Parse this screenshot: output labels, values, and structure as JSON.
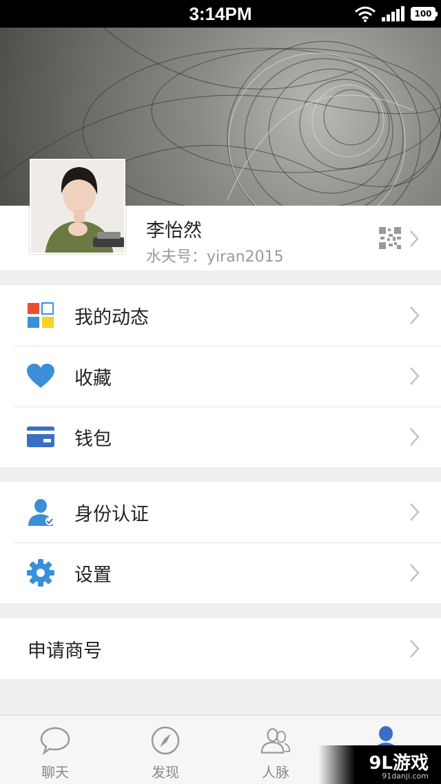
{
  "status_bar": {
    "time": "3:14PM",
    "battery": "100"
  },
  "profile": {
    "name": "李怡然",
    "account_label": "水夫号：",
    "account_id": "yiran2015"
  },
  "menu_group_1": [
    {
      "label": "我的动态",
      "icon": "moments-icon"
    },
    {
      "label": "收藏",
      "icon": "heart-icon"
    },
    {
      "label": "钱包",
      "icon": "wallet-card-icon"
    }
  ],
  "menu_group_2": [
    {
      "label": "身份认证",
      "icon": "verified-user-icon"
    },
    {
      "label": "设置",
      "icon": "gear-icon"
    }
  ],
  "menu_group_3": [
    {
      "label": "申请商号"
    }
  ],
  "tabbar": [
    {
      "label": "聊天",
      "icon": "chat-bubble-icon"
    },
    {
      "label": "发现",
      "icon": "compass-icon"
    },
    {
      "label": "人脉",
      "icon": "contacts-icon"
    },
    {
      "label": "",
      "icon": "me-icon"
    }
  ],
  "watermark": {
    "brand": "9L游戏",
    "url": "91danji.com"
  },
  "colors": {
    "accent": "#4a90d9",
    "text": "#222222",
    "secondary": "#999999"
  }
}
